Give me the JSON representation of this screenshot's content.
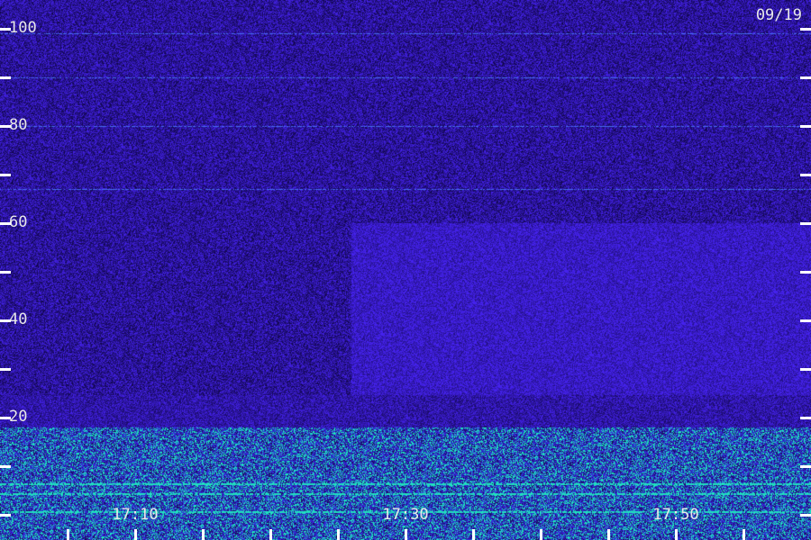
{
  "chart_data": {
    "type": "heatmap",
    "title": "",
    "xlabel": "",
    "ylabel": "",
    "date_label": "09/19",
    "ylim": [
      0,
      100
    ],
    "y_ticks": [
      0,
      10,
      20,
      30,
      40,
      50,
      60,
      70,
      80,
      90,
      100
    ],
    "y_tick_labels": [
      {
        "value": 20,
        "label": "20"
      },
      {
        "value": 40,
        "label": "40"
      },
      {
        "value": 60,
        "label": "60"
      },
      {
        "value": 80,
        "label": "80"
      },
      {
        "value": 100,
        "label": "100"
      }
    ],
    "x_range_minutes": [
      "17:00",
      "18:00"
    ],
    "x_tick_labels": [
      {
        "time": "17:10",
        "label": "17:10"
      },
      {
        "time": "17:30",
        "label": "17:30"
      },
      {
        "time": "17:50",
        "label": "17:50"
      }
    ],
    "x_minor_tick_interval_minutes": 5,
    "colors": {
      "background": "#1a0a5e",
      "noise_dim": "#0d0638",
      "noise_bright": "#3a2ad8",
      "band": "#3040e8",
      "low_band": "#20e0c0",
      "tick": "#ffffff",
      "text": "#e8e8e8"
    },
    "features": {
      "lines_y": [
        99,
        90,
        80,
        67
      ],
      "burst_start_time": "17:26",
      "burst_y_range": [
        20,
        60
      ],
      "low_band_y_range": [
        0,
        18
      ]
    }
  }
}
